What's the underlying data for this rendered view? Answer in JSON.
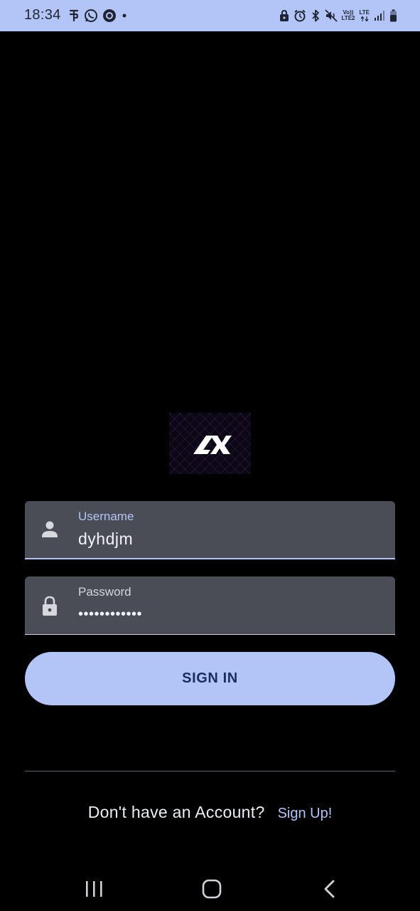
{
  "status_bar": {
    "time": "18:34",
    "left_icons": [
      "phonepe-icon",
      "whatsapp-icon",
      "circle-notification-icon",
      "dot-icon"
    ],
    "right_icons": [
      "lock-icon",
      "alarm-icon",
      "bluetooth-icon",
      "mute-icon",
      "volte-icon",
      "lte-icon",
      "signal-icon",
      "battery-icon"
    ],
    "volte_line1": "Vo))",
    "volte_line2": "LTE2",
    "lte_label": "LTE"
  },
  "login": {
    "logo_icon": "app-logo",
    "username": {
      "label": "Username",
      "value": "dyhdjm",
      "icon": "person-icon"
    },
    "password": {
      "label": "Password",
      "value_masked": "••••••••••••",
      "icon": "lock-icon"
    },
    "signin_label": "SIGN IN"
  },
  "footer": {
    "prompt": "Don't have an Account?",
    "signup_label": "Sign Up!"
  },
  "nav": {
    "items": [
      "recent-apps-icon",
      "home-icon",
      "back-icon"
    ]
  },
  "colors": {
    "accent": "#b3c5f7",
    "field_bg": "#4a4d56",
    "button_text": "#1b2d5c",
    "background": "#000000"
  }
}
